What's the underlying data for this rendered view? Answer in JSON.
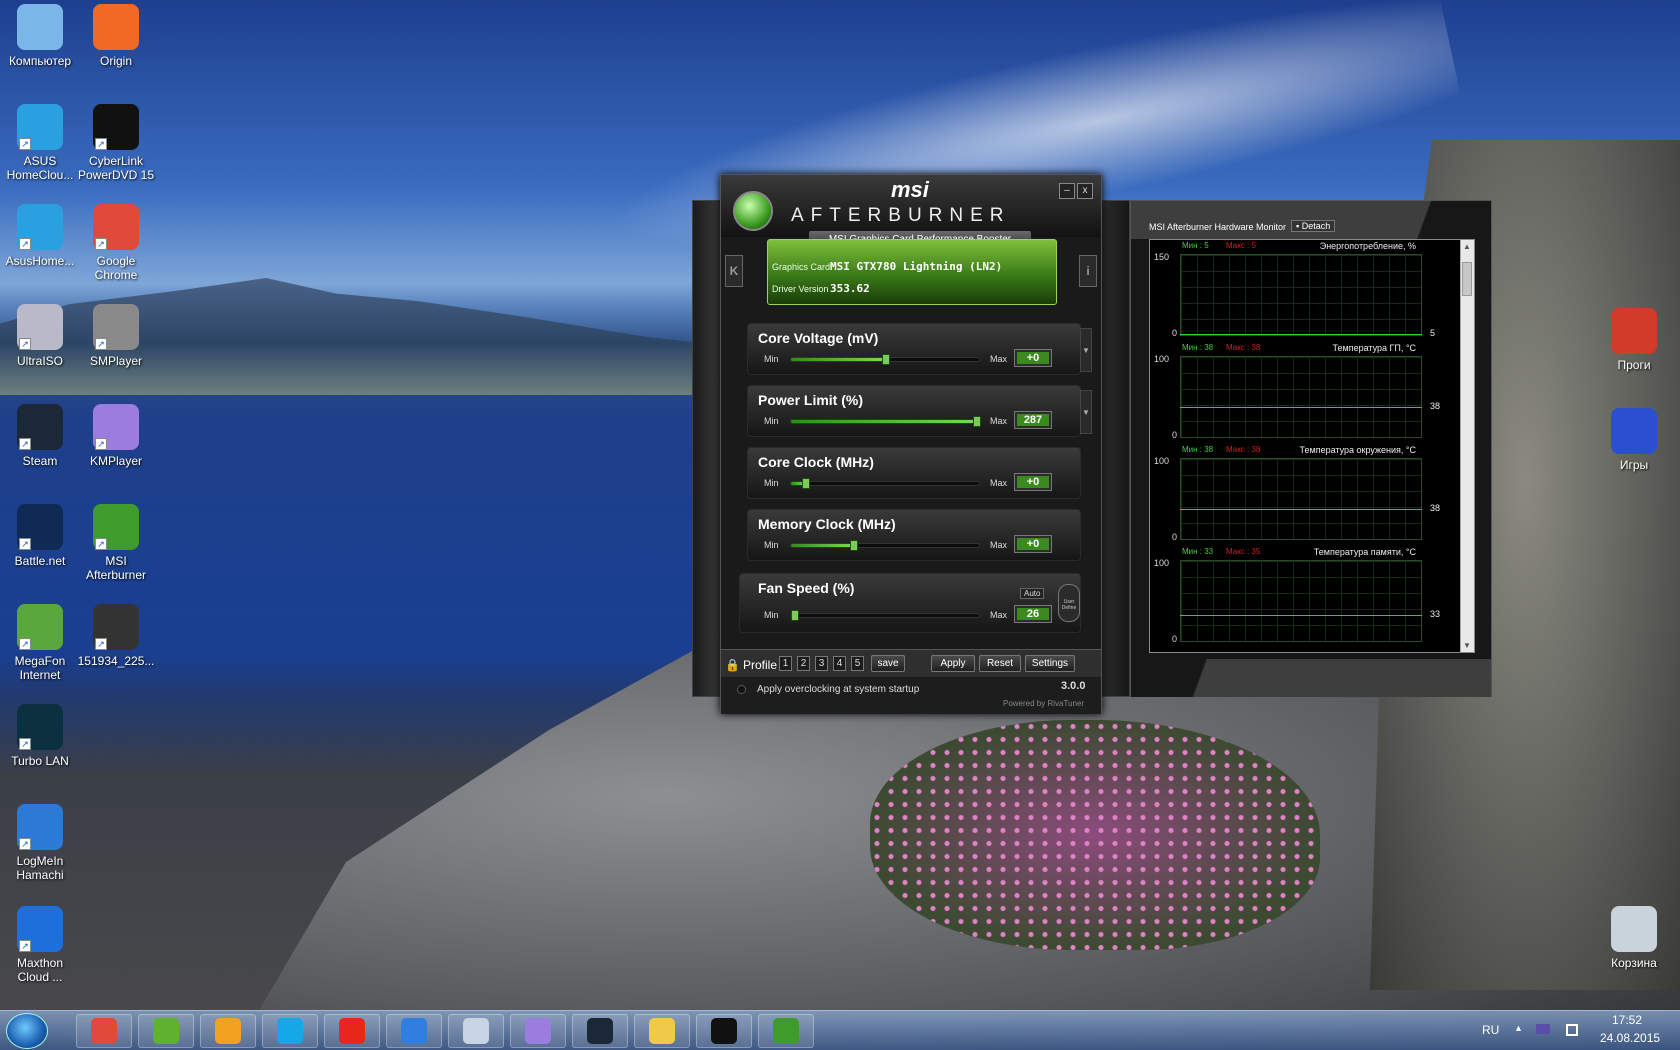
{
  "desktop": {
    "icons": [
      {
        "label": "Компьютер",
        "icon": "computer-icon",
        "color": "#7ab7e8"
      },
      {
        "label": "Origin",
        "icon": "origin-icon",
        "color": "#f06a25"
      },
      {
        "label": "ASUS HomeClou...",
        "icon": "asus-cloud-icon",
        "color": "#2aa0e0"
      },
      {
        "label": "CyberLink PowerDVD 15",
        "icon": "powerdvd-icon",
        "color": "#111111"
      },
      {
        "label": "AsusHome...",
        "icon": "asus-home-icon",
        "color": "#2aa0e0"
      },
      {
        "label": "Google Chrome",
        "icon": "chrome-icon",
        "color": "#e14a3b"
      },
      {
        "label": "UltraISO",
        "icon": "ultraiso-icon",
        "color": "#b9b9c9"
      },
      {
        "label": "SMPlayer",
        "icon": "smplayer-icon",
        "color": "#8a8a8a"
      },
      {
        "label": "Steam",
        "icon": "steam-icon",
        "color": "#1b2838"
      },
      {
        "label": "KMPlayer",
        "icon": "kmplayer-icon",
        "color": "#9b7de0"
      },
      {
        "label": "Battle.net",
        "icon": "battlenet-icon",
        "color": "#0e2a55"
      },
      {
        "label": "MSI Afterburner",
        "icon": "afterburner-icon",
        "color": "#3e9b2c"
      },
      {
        "label": "MegaFon Internet",
        "icon": "megafon-icon",
        "color": "#5aa83d"
      },
      {
        "label": "151934_225...",
        "icon": "image-file-icon",
        "color": "#333333"
      },
      {
        "label": "Turbo LAN",
        "icon": "turbolan-icon",
        "color": "#0b3040"
      },
      {
        "label": "LogMeIn Hamachi",
        "icon": "hamachi-icon",
        "color": "#2a7ad6"
      },
      {
        "label": "Maxthon Cloud ...",
        "icon": "maxthon-icon",
        "color": "#1e6fd9"
      },
      {
        "label": "Проги",
        "icon": "folder-progs-icon",
        "color": "#d23a2a"
      },
      {
        "label": "Игры",
        "icon": "folder-games-icon",
        "color": "#2a4fd0"
      },
      {
        "label": "Корзина",
        "icon": "recycle-bin-icon",
        "color": "#c9d3dc"
      }
    ]
  },
  "afterburner": {
    "brand": "msi",
    "title": "AFTERBURNER",
    "tagline": "MSI Graphics Card Performance Booster",
    "graphics_card_label": "Graphics Card",
    "graphics_card": "MSI GTX780 Lightning (LN2)",
    "driver_label": "Driver Version",
    "driver": "353.62",
    "minimize": "–",
    "close": "x",
    "left_tab": "K",
    "info_tab": "i",
    "min_label": "Min",
    "max_label": "Max",
    "sliders": [
      {
        "name": "Core Voltage (mV)",
        "value": "+0",
        "level": 0.5
      },
      {
        "name": "Power Limit (%)",
        "value": "287",
        "level": 1.0
      },
      {
        "name": "Core Clock (MHz)",
        "value": "+0",
        "level": 0.08
      },
      {
        "name": "Memory Clock (MHz)",
        "value": "+0",
        "level": 0.33
      },
      {
        "name": "Fan Speed (%)",
        "value": "26",
        "level": 0.0
      }
    ],
    "fan_auto": "Auto",
    "user_define": "User Define",
    "profile_label": "Profile",
    "profiles": [
      "1",
      "2",
      "3",
      "4",
      "5"
    ],
    "save": "save",
    "apply": "Apply",
    "reset": "Reset",
    "settings": "Settings",
    "startup": "Apply overclocking at system startup",
    "version": "3.0.0",
    "powered": "Powered by RivaTuner",
    "accent": "#3a8a1f"
  },
  "monitor": {
    "title": "MSI Afterburner Hardware Monitor",
    "detach": "Detach",
    "panes": [
      {
        "name": "Энергопотребление, %",
        "min": "Мин : 5",
        "max": "Макс : 5",
        "ytop": "150",
        "ybottom": "0",
        "current": "5",
        "level": 0.03
      },
      {
        "name": "Температура ГП, °C",
        "min": "Мин : 38",
        "max": "Макс : 38",
        "ytop": "100",
        "ybottom": "0",
        "current": "38",
        "level": 0.38
      },
      {
        "name": "Температура окружения, °C",
        "min": "Мин : 38",
        "max": "Макс : 38",
        "ytop": "100",
        "ybottom": "0",
        "current": "38",
        "level": 0.38
      },
      {
        "name": "Температура памяти, °C",
        "min": "Мин : 33",
        "max": "Макс : 35",
        "ytop": "100",
        "ybottom": "0",
        "current": "33",
        "level": 0.33
      }
    ]
  },
  "taskbar": {
    "apps": [
      {
        "icon": "chrome-taskbar-icon",
        "color": "#e14a3b"
      },
      {
        "icon": "utorrent-taskbar-icon",
        "color": "#5fb12f"
      },
      {
        "icon": "media-player-taskbar-icon",
        "color": "#f2a020"
      },
      {
        "icon": "skype-taskbar-icon",
        "color": "#16a7e8"
      },
      {
        "icon": "yandex-taskbar-icon",
        "color": "#e8261a"
      },
      {
        "icon": "itunes-taskbar-icon",
        "color": "#2f7ee0"
      },
      {
        "icon": "calculator-taskbar-icon",
        "color": "#c8d4e4"
      },
      {
        "icon": "kmplayer-taskbar-icon",
        "color": "#9b7de0"
      },
      {
        "icon": "steam-taskbar-icon",
        "color": "#1b2838"
      },
      {
        "icon": "explorer-taskbar-icon",
        "color": "#f0c94a"
      },
      {
        "icon": "powerdvd-taskbar-icon",
        "color": "#111111"
      },
      {
        "icon": "afterburner-taskbar-icon",
        "color": "#3e9b2c"
      }
    ],
    "lang": "RU",
    "time": "17:52",
    "date": "24.08.2015"
  }
}
